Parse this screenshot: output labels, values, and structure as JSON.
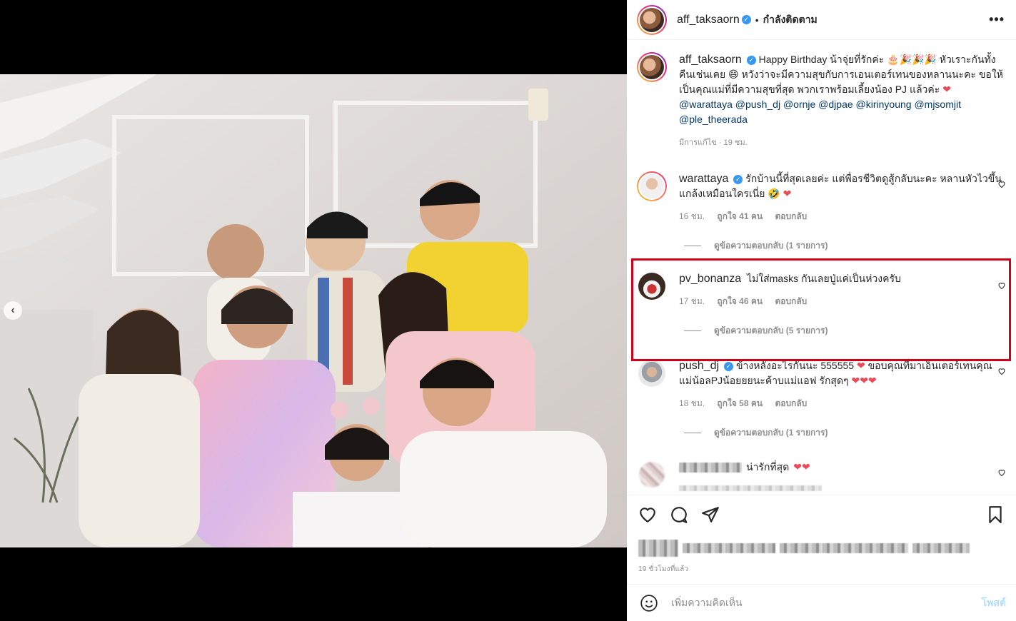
{
  "header": {
    "username": "aff_taksaorn",
    "separator": "•",
    "follow_status": "กำลังติดตาม",
    "more": "•••"
  },
  "media": {
    "prev_arrow": "‹"
  },
  "caption": {
    "username": "aff_taksaorn",
    "text_1": "Happy Birthday น้าจุ่ยที่รักค่ะ 🎂🎉🎉🎉 หัวเราะกันทั้งคืนเช่นเคย 😄 หวังว่าจะมีความสุขกับการเอนเตอร์เทนของหลานนะคะ ขอให้เป็นคุณแม่ที่มีความสุขที่สุด พวกเราพร้อมเลี้ยงน้อง PJ แล้วค่ะ ",
    "heart": "❤",
    "mentions": "@warattaya @push_dj @ornje @djpae @kirinyoung @mjsomjit @ple_theerada",
    "meta": "มีการแก้ไข · 19 ชม."
  },
  "comments": [
    {
      "username": "warattaya",
      "text": "รักบ้านนี้ที่สุดเลยค่ะ แต่พื่อรชีวิตดูสู้กลับนะคะ หลานหัวไวขึ้นแกล้งเหมือนใครเนี่ย 🤣",
      "heart": "❤",
      "time": "16 ชม.",
      "likes": "ถูกใจ 41 คน",
      "reply": "ตอบกลับ",
      "view_replies": "ดูข้อความตอบกลับ (1 รายการ)"
    },
    {
      "username": "pv_bonanza",
      "text": "ไม่ใส่masks กันเลยปู่แค่เป็นห่วงครับ",
      "time": "17 ชม.",
      "likes": "ถูกใจ 46 คน",
      "reply": "ตอบกลับ",
      "view_replies": "ดูข้อความตอบกลับ (5 รายการ)"
    },
    {
      "username": "push_dj",
      "text_1": "ข้างหลังอะไรกันนะ 555555 ",
      "text_2": " ขอบคุณที่มาเอ็นเตอร์เทนคุณแม่น้อลPJน้อยยยนะค้าบแม่แอฟ รักสุดๆ",
      "hearts": "❤❤❤",
      "heart": "❤",
      "time": "18 ชม.",
      "likes": "ถูกใจ 58 คน",
      "reply": "ตอบกลับ",
      "view_replies": "ดูข้อความตอบกลับ (1 รายการ)"
    },
    {
      "text": "น่ารักที่สุด",
      "hearts": "❤❤"
    }
  ],
  "footer": {
    "time_ago": "19 ชั่วโมงที่แล้ว",
    "comment_placeholder": "เพิ่มความคิดเห็น...",
    "comment_display": "เพิ่มความคิดเห็น",
    "post_label": "โพสต์"
  }
}
